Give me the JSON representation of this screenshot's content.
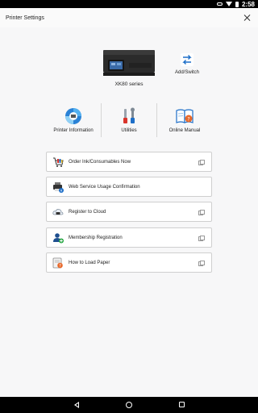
{
  "status_bar": {
    "time": "2:58"
  },
  "header": {
    "title": "Printer Settings"
  },
  "printer": {
    "name": "XK80 series"
  },
  "add_switch": {
    "label": "Add/Switch"
  },
  "functions": [
    {
      "label": "Printer Information",
      "icon": "printer-information-icon"
    },
    {
      "label": "Utilities",
      "icon": "utilities-icon"
    },
    {
      "label": "Online Manual",
      "icon": "online-manual-icon"
    }
  ],
  "menu": [
    {
      "label": "Order Ink/Consumables Now",
      "icon": "cart-icon",
      "external": true
    },
    {
      "label": "Web Service Usage Confirmation",
      "icon": "printer-info-icon",
      "external": false
    },
    {
      "label": "Register to Cloud",
      "icon": "cloud-icon",
      "external": true
    },
    {
      "label": "Membership Registration",
      "icon": "add-member-icon",
      "external": true
    },
    {
      "label": "How to Load Paper",
      "icon": "paper-help-icon",
      "external": true
    }
  ],
  "colors": {
    "accent_blue": "#1e6fc8",
    "accent_red": "#d9342b",
    "accent_green": "#27a644"
  }
}
